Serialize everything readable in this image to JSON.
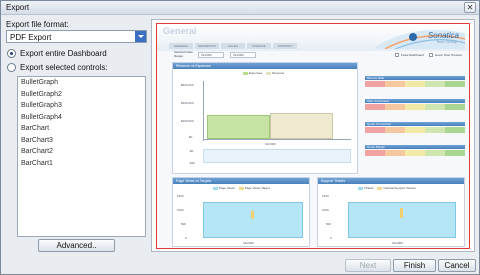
{
  "window": {
    "title": "Export",
    "close_glyph": "✕"
  },
  "export_format": {
    "label": "Export file format:",
    "value": "PDF Export"
  },
  "options": [
    {
      "label": "Export entire Dashboard",
      "selected": true
    },
    {
      "label": "Export selected controls:",
      "selected": false
    }
  ],
  "controls": [
    "BulletGraph",
    "BulletGraph2",
    "BulletGraph3",
    "BulletGraph4",
    "BarChart",
    "BarChart3",
    "BarChart2",
    "BarChart1"
  ],
  "buttons": {
    "advanced": "Advanced..",
    "next": "Next",
    "finish": "Finish",
    "cancel": "Cancel"
  },
  "preview": {
    "title": "General",
    "logo": "Sonatica",
    "logo_sub": "Tech Group",
    "tabs": [
      "GENERAL",
      "MARKETING",
      "SALES",
      "FINANCE",
      "SUPPORT"
    ],
    "filter": {
      "label": "Selected Date Range:",
      "from": "01/2006",
      "to": "01/2006"
    },
    "legend_top": [
      "Fixed Dashboard",
      "Hover Over Preview"
    ],
    "panels": {
      "revenue": {
        "title": "Revenue vs Expenses",
        "legend": [
          "Expenses",
          "Revenue"
        ],
        "yticks": [
          "$600,000",
          "$400,000",
          "$200,000",
          "$0",
          "-$0",
          "-$20"
        ],
        "ylabel": "Revenue vs Expenses",
        "ylabel2": "Gross Margin",
        "xlabel": "01/2006"
      },
      "page_views": {
        "title": "Page Views vs Targets",
        "legend": [
          "Page Views",
          "Page Views Target"
        ],
        "yticks": [
          "1500",
          "1000",
          "500",
          "0"
        ],
        "ylabel": "Page Views",
        "xlabel": "01/2006"
      },
      "support": {
        "title": "Support Tickets",
        "legend": [
          "Tickets",
          "Optimal Support Volume"
        ],
        "yticks": [
          "1500",
          "1000",
          "500",
          "0"
        ],
        "ylabel": "No. of tickets",
        "xlabel": "01/2006"
      }
    },
    "gauges": [
      {
        "title": "Bounce Rate",
        "ticks": [
          "0%",
          "20%",
          "40%",
          "60%",
          "80%",
          "100%"
        ]
      },
      {
        "title": "Web Conversion",
        "ticks": [
          "0%",
          "20%",
          "40%",
          "60%",
          "80%",
          "100%"
        ]
      },
      {
        "title": "Quote Conversion",
        "ticks": [
          "0%",
          "20%",
          "40%",
          "60%",
          "80%",
          "100%"
        ]
      },
      {
        "title": "Gross Margin",
        "ticks": [
          "0%",
          "20%",
          "40%",
          "60%",
          "80%",
          "100%"
        ]
      }
    ],
    "gauge_end": "1.0"
  },
  "colors": {
    "accent": "#3a6fc2",
    "preview_border": "#e33a3a",
    "panel_header": "#5a8fc8",
    "bar_green": "#b9dd8a",
    "bar_cyan": "#9fdcf0"
  }
}
